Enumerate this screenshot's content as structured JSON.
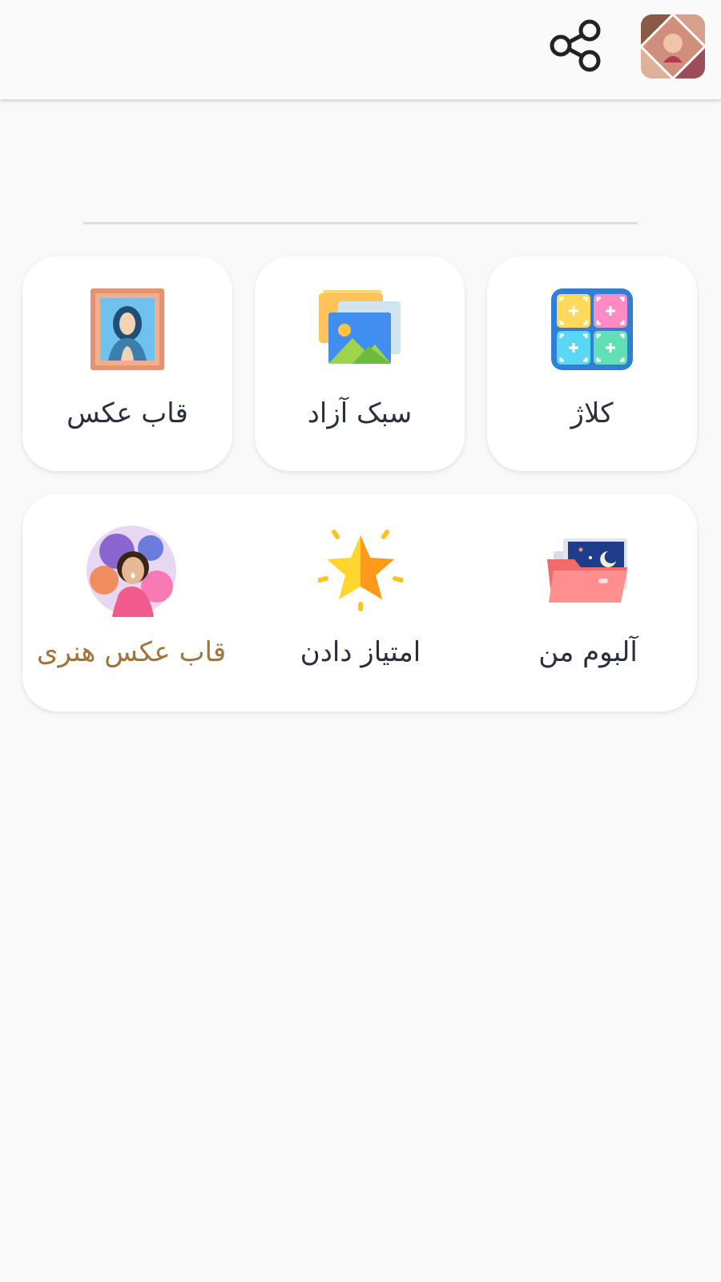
{
  "tiles_top": [
    {
      "label": "کلاژ",
      "icon": "collage-grid-icon"
    },
    {
      "label": "سبک آزاد",
      "icon": "freestyle-images-icon"
    },
    {
      "label": "قاب عکس",
      "icon": "picture-frame-icon"
    }
  ],
  "tiles_bottom": [
    {
      "label": "آلبوم من",
      "icon": "album-folder-icon"
    },
    {
      "label": "امتیاز دادن",
      "icon": "star-rate-icon"
    },
    {
      "label": "قاب عکس هنری",
      "icon": "art-frame-avatar-icon"
    }
  ],
  "colors": {
    "background": "#f9f9f9",
    "card": "#ffffff",
    "label": "#2a2f3d",
    "accent_label": "#a3733a"
  }
}
